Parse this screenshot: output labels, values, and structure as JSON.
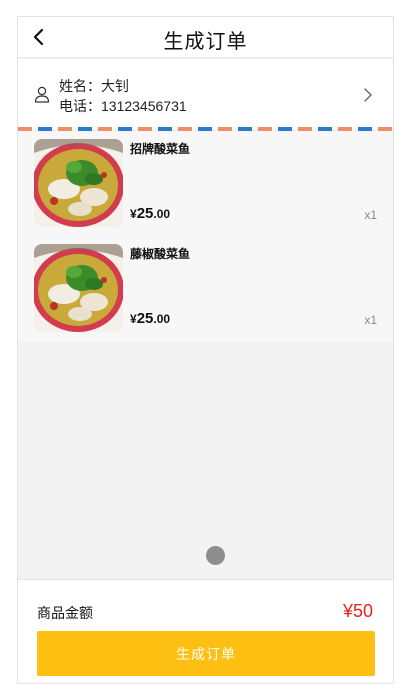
{
  "header": {
    "title": "生成订单",
    "back_icon": "chevron-left-icon"
  },
  "contact": {
    "name_label": "姓名：",
    "name_value": "大钊",
    "phone_label": "电话：",
    "phone_value": "13123456731",
    "user_icon": "user-icon",
    "chevron_icon": "chevron-right-icon"
  },
  "items": [
    {
      "name": "招牌酸菜鱼",
      "currency": "¥",
      "price_int": "25",
      "price_dec": ".00",
      "qty": "x1"
    },
    {
      "name": "藤椒酸菜鱼",
      "currency": "¥",
      "price_int": "25",
      "price_dec": ".00",
      "qty": "x1"
    }
  ],
  "footer": {
    "total_label": "商品金额",
    "total_value": "¥50",
    "submit_label": "生成订单"
  },
  "colors": {
    "accent": "#fcbf12",
    "price_red": "#e52420",
    "stripe_orange": "#e89069",
    "stripe_blue": "#2a7cc6"
  }
}
